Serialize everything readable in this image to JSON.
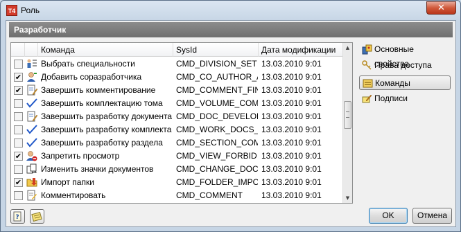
{
  "window": {
    "title": "Роль",
    "app_icon": "T4",
    "close_glyph": "✕"
  },
  "header": {
    "title": "Разработчик"
  },
  "grid": {
    "columns": [
      "Команда",
      "SysId",
      "Дата модификации"
    ],
    "rows": [
      {
        "checked": false,
        "icon": "list-person-icon",
        "name": "Выбрать специальности",
        "sysid": "CMD_DIVISION_SET",
        "date": "13.03.2010 9:01"
      },
      {
        "checked": true,
        "icon": "user-add-icon",
        "name": "Добавить соразработчика",
        "sysid": "CMD_CO_AUTHOR_AP",
        "date": "13.03.2010 9:01"
      },
      {
        "checked": true,
        "icon": "document-edit-icon",
        "name": "Завершить комментирование",
        "sysid": "CMD_COMMENT_FINI",
        "date": "13.03.2010 9:01"
      },
      {
        "checked": false,
        "icon": "checkmark-icon",
        "name": "Завершить комплектацию тома",
        "sysid": "CMD_VOLUME_COMP",
        "date": "13.03.2010 9:01"
      },
      {
        "checked": false,
        "icon": "document-edit-icon",
        "name": "Завершить разработку документа",
        "sysid": "CMD_DOC_DEVELOPE",
        "date": "13.03.2010 9:01"
      },
      {
        "checked": false,
        "icon": "checkmark-icon",
        "name": "Завершить разработку комплекта",
        "sysid": "CMD_WORK_DOCS_SE",
        "date": "13.03.2010 9:01"
      },
      {
        "checked": false,
        "icon": "checkmark-icon",
        "name": "Завершить разработку раздела",
        "sysid": "CMD_SECTION_COMP",
        "date": "13.03.2010 9:01"
      },
      {
        "checked": true,
        "icon": "user-forbid-icon",
        "name": "Запретить просмотр",
        "sysid": "CMD_VIEW_FORBID",
        "date": "13.03.2010 9:01"
      },
      {
        "checked": false,
        "icon": "document-change-icon",
        "name": "Изменить значки документов",
        "sysid": "CMD_CHANGE_DOC_I",
        "date": "13.03.2010 9:01"
      },
      {
        "checked": true,
        "icon": "folder-import-icon",
        "name": "Импорт папки",
        "sysid": "CMD_FOLDER_IMPORT",
        "date": "13.03.2010 9:01"
      },
      {
        "checked": false,
        "icon": "comment-icon",
        "name": "Комментировать",
        "sysid": "CMD_COMMENT",
        "date": "13.03.2010 9:01"
      }
    ]
  },
  "sidebar": {
    "items": [
      {
        "label": "Основные свойства",
        "icon": "properties-icon",
        "active": false
      },
      {
        "label": "Права доступа",
        "icon": "keys-icon",
        "active": false
      },
      {
        "label": "Команды",
        "icon": "commands-icon",
        "active": true
      },
      {
        "label": "Подписи",
        "icon": "signature-icon",
        "active": false
      }
    ]
  },
  "buttons": {
    "ok": "OK",
    "cancel": "Отмена"
  },
  "colors": {
    "header_bg": "#7d7d7d",
    "title_bg": "#c6d5e5",
    "close_red": "#c4452a"
  }
}
